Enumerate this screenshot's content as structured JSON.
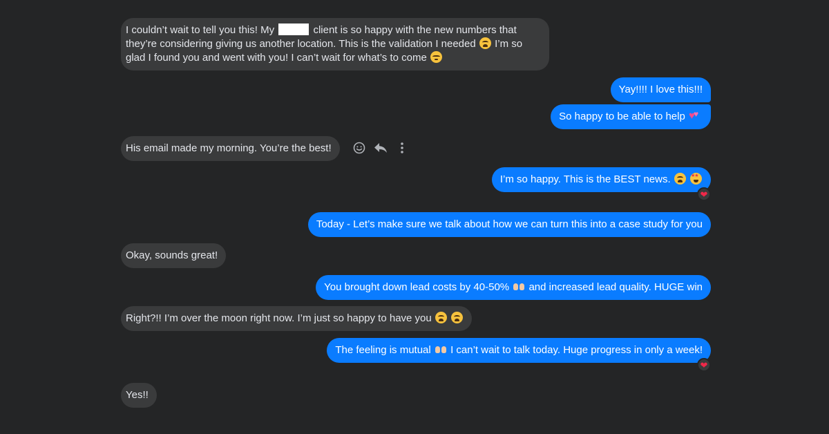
{
  "messages": [
    {
      "part1": "I couldn’t wait to tell you this! My",
      "part2": "client is so happy with the new numbers that they’re considering giving us another location. This is the validation I needed",
      "part3": "I’m so glad I found you and went with you! I can’t wait for what’s to come",
      "emojis": [
        "loudly-crying-face",
        "face-holding-back-tears"
      ]
    },
    {
      "text": "Yay!!!! I love this!!!"
    },
    {
      "text": "So happy to be able to help",
      "emojis": [
        "two-hearts"
      ]
    },
    {
      "text": "His email made my morning. You’re the best!"
    },
    {
      "text": "I’m so happy. This is the BEST news.",
      "emojis": [
        "loudly-crying-face",
        "star-struck"
      ],
      "reaction": "❤"
    },
    {
      "text": "Today - Let’s make sure we talk about how we can turn this into a case study for you"
    },
    {
      "text": "Okay, sounds great!"
    },
    {
      "part1": "You brought down lead costs by 40-50%",
      "part2": "and increased lead quality. HUGE win",
      "emojis": [
        "raising-hands"
      ]
    },
    {
      "text": "Right?!! I’m over the moon right now. I’m just so happy to have you",
      "emojis": [
        "loudly-crying-face",
        "loudly-crying-face"
      ]
    },
    {
      "part1": "The feeling is mutual",
      "part2": "I can’t wait to talk today. Huge progress in only a week!",
      "emojis": [
        "raising-hands"
      ],
      "reaction": "❤"
    },
    {
      "text": "Yes!!"
    }
  ],
  "hover_actions": [
    "react-icon",
    "reply-icon",
    "more-icon"
  ],
  "colors": {
    "background": "#242526",
    "incoming_bubble": "#3a3b3c",
    "outgoing_bubble": "#0a7cff",
    "reaction_heart": "#f02849"
  }
}
